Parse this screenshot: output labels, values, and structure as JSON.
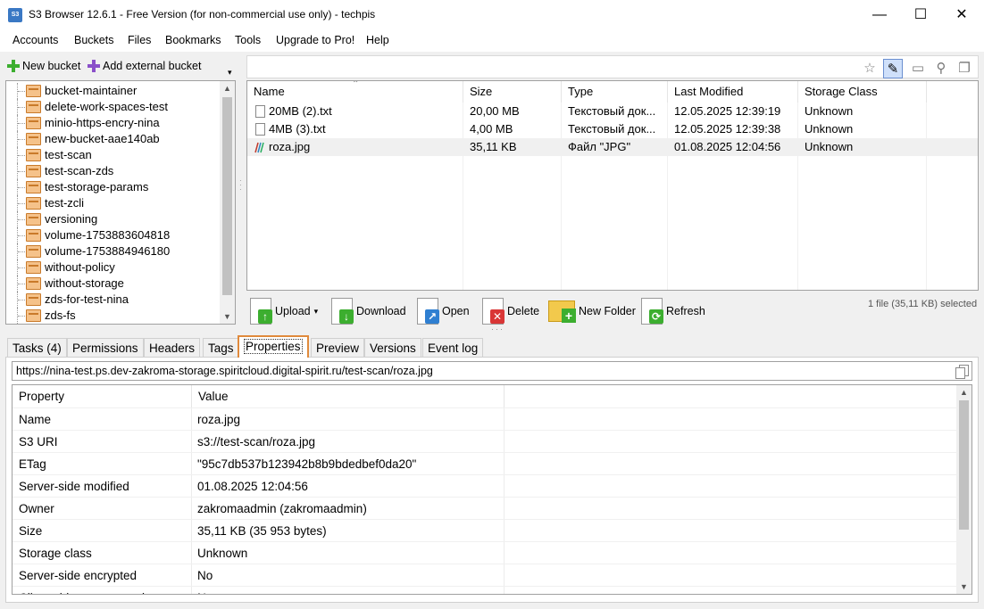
{
  "window": {
    "icon_text": "S3",
    "title": "S3 Browser 12.6.1 - Free Version (for non-commercial use only) - techpis",
    "minimize": "—",
    "maximize": "☐",
    "close": "✕"
  },
  "menu": [
    "Accounts",
    "Buckets",
    "Files",
    "Bookmarks",
    "Tools",
    "Upgrade to Pro!",
    "Help"
  ],
  "left_toolbar": {
    "new_bucket": "New bucket",
    "add_external_bucket": "Add external bucket"
  },
  "buckets": [
    "bucket-maintainer",
    "delete-work-spaces-test",
    "minio-https-encry-nina",
    "new-bucket-aae140ab",
    "test-scan",
    "test-scan-zds",
    "test-storage-params",
    "test-zcli",
    "versioning",
    "volume-1753883604818",
    "volume-1753884946180",
    "without-policy",
    "without-storage",
    "zds-for-test-nina",
    "zds-fs"
  ],
  "file_columns": [
    "Name",
    "Size",
    "Type",
    "Last Modified",
    "Storage Class"
  ],
  "files": [
    {
      "name": "20MB (2).txt",
      "size": "20,00 MB",
      "type": "Текстовый док...",
      "modified": "12.05.2025 12:39:19",
      "storage": "Unknown",
      "icon": "text-file-icon"
    },
    {
      "name": "4MB (3).txt",
      "size": "4,00 MB",
      "type": "Текстовый док...",
      "modified": "12.05.2025 12:39:38",
      "storage": "Unknown",
      "icon": "text-file-icon"
    },
    {
      "name": "roza.jpg",
      "size": "35,11 KB",
      "type": "Файл \"JPG\"",
      "modified": "01.08.2025 12:04:56",
      "storage": "Unknown",
      "icon": "image-file-icon"
    }
  ],
  "file_actions": {
    "upload": "Upload",
    "download": "Download",
    "open": "Open",
    "delete": "Delete",
    "new_folder": "New Folder",
    "refresh": "Refresh"
  },
  "selection_status": "1 file (35,11 KB) selected",
  "tabs": [
    "Tasks (4)",
    "Permissions",
    "Headers",
    "Tags",
    "Properties",
    "Preview",
    "Versions",
    "Event log"
  ],
  "active_tab": "Properties",
  "url": "https://nina-test.ps.dev-zakroma-storage.spiritcloud.digital-spirit.ru/test-scan/roza.jpg",
  "properties_header": {
    "property": "Property",
    "value": "Value"
  },
  "properties": [
    {
      "property": "Name",
      "value": "roza.jpg"
    },
    {
      "property": "S3 URI",
      "value": "s3://test-scan/roza.jpg"
    },
    {
      "property": "ETag",
      "value": "\"95c7db537b123942b8b9bdedbef0da20\""
    },
    {
      "property": "Server-side modified",
      "value": "01.08.2025 12:04:56"
    },
    {
      "property": "Owner",
      "value": "zakromaadmin (zakromaadmin)"
    },
    {
      "property": "Size",
      "value": "35,11 KB (35 953 bytes)"
    },
    {
      "property": "Storage class",
      "value": "Unknown"
    },
    {
      "property": "Server-side encrypted",
      "value": "No"
    },
    {
      "property": "Client-side compressed",
      "value": "No"
    }
  ],
  "colors": {
    "active_tab_border": "#e08a3c",
    "add_icon": "#3cae2f",
    "external_add_icon": "#8a4fc9"
  }
}
